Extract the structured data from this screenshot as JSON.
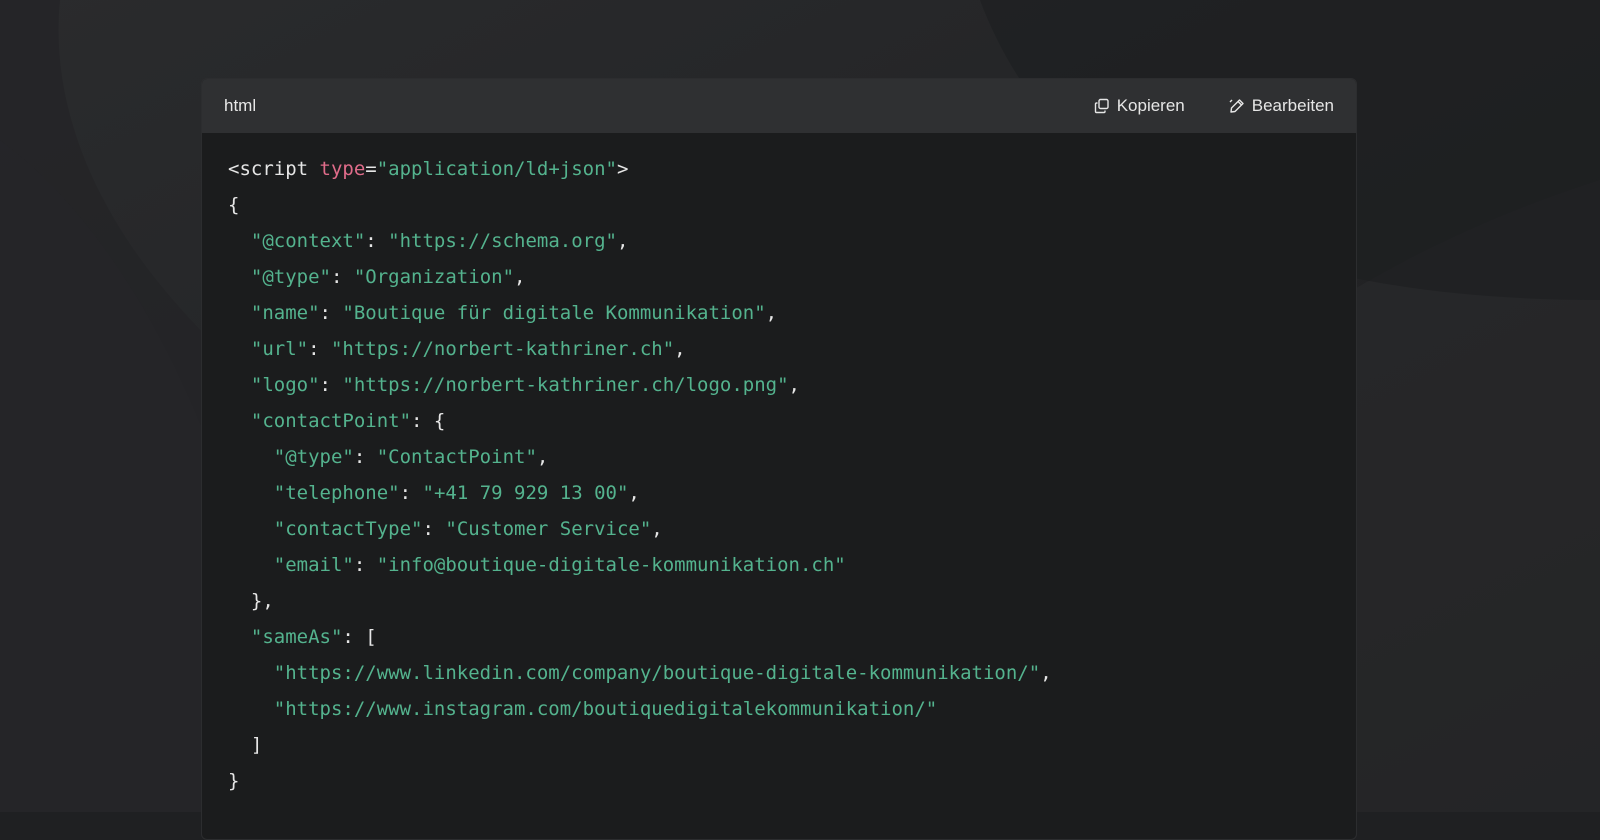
{
  "header": {
    "language": "html",
    "copy_label": "Kopieren",
    "edit_label": "Bearbeiten"
  },
  "icons": {
    "copy": "copy-icon",
    "edit": "pencil-icon"
  },
  "colors": {
    "string": "#54b38e",
    "attribute": "#e06c8a",
    "text": "#e6e6e6",
    "header_bg": "#2f3032",
    "code_bg": "#1b1c1d"
  },
  "code_lines": [
    [
      {
        "t": "<script ",
        "c": "plain"
      },
      {
        "t": "type",
        "c": "attr"
      },
      {
        "t": "=",
        "c": "plain"
      },
      {
        "t": "\"application/ld+json\"",
        "c": "str"
      },
      {
        "t": ">",
        "c": "plain"
      }
    ],
    [
      {
        "t": "{",
        "c": "plain"
      }
    ],
    [
      {
        "t": "  ",
        "c": "plain"
      },
      {
        "t": "\"@context\"",
        "c": "str"
      },
      {
        "t": ": ",
        "c": "plain"
      },
      {
        "t": "\"https://schema.org\"",
        "c": "str"
      },
      {
        "t": ",",
        "c": "plain"
      }
    ],
    [
      {
        "t": "  ",
        "c": "plain"
      },
      {
        "t": "\"@type\"",
        "c": "str"
      },
      {
        "t": ": ",
        "c": "plain"
      },
      {
        "t": "\"Organization\"",
        "c": "str"
      },
      {
        "t": ",",
        "c": "plain"
      }
    ],
    [
      {
        "t": "  ",
        "c": "plain"
      },
      {
        "t": "\"name\"",
        "c": "str"
      },
      {
        "t": ": ",
        "c": "plain"
      },
      {
        "t": "\"Boutique für digitale Kommunikation\"",
        "c": "str"
      },
      {
        "t": ",",
        "c": "plain"
      }
    ],
    [
      {
        "t": "  ",
        "c": "plain"
      },
      {
        "t": "\"url\"",
        "c": "str"
      },
      {
        "t": ": ",
        "c": "plain"
      },
      {
        "t": "\"https://norbert-kathriner.ch\"",
        "c": "str"
      },
      {
        "t": ",",
        "c": "plain"
      }
    ],
    [
      {
        "t": "  ",
        "c": "plain"
      },
      {
        "t": "\"logo\"",
        "c": "str"
      },
      {
        "t": ": ",
        "c": "plain"
      },
      {
        "t": "\"https://norbert-kathriner.ch/logo.png\"",
        "c": "str"
      },
      {
        "t": ",",
        "c": "plain"
      }
    ],
    [
      {
        "t": "  ",
        "c": "plain"
      },
      {
        "t": "\"contactPoint\"",
        "c": "str"
      },
      {
        "t": ": {",
        "c": "plain"
      }
    ],
    [
      {
        "t": "    ",
        "c": "plain"
      },
      {
        "t": "\"@type\"",
        "c": "str"
      },
      {
        "t": ": ",
        "c": "plain"
      },
      {
        "t": "\"ContactPoint\"",
        "c": "str"
      },
      {
        "t": ",",
        "c": "plain"
      }
    ],
    [
      {
        "t": "    ",
        "c": "plain"
      },
      {
        "t": "\"telephone\"",
        "c": "str"
      },
      {
        "t": ": ",
        "c": "plain"
      },
      {
        "t": "\"+41 79 929 13 00\"",
        "c": "str"
      },
      {
        "t": ",",
        "c": "plain"
      }
    ],
    [
      {
        "t": "    ",
        "c": "plain"
      },
      {
        "t": "\"contactType\"",
        "c": "str"
      },
      {
        "t": ": ",
        "c": "plain"
      },
      {
        "t": "\"Customer Service\"",
        "c": "str"
      },
      {
        "t": ",",
        "c": "plain"
      }
    ],
    [
      {
        "t": "    ",
        "c": "plain"
      },
      {
        "t": "\"email\"",
        "c": "str"
      },
      {
        "t": ": ",
        "c": "plain"
      },
      {
        "t": "\"info@boutique-digitale-kommunikation.ch\"",
        "c": "str"
      }
    ],
    [
      {
        "t": "  },",
        "c": "plain"
      }
    ],
    [
      {
        "t": "  ",
        "c": "plain"
      },
      {
        "t": "\"sameAs\"",
        "c": "str"
      },
      {
        "t": ": [",
        "c": "plain"
      }
    ],
    [
      {
        "t": "    ",
        "c": "plain"
      },
      {
        "t": "\"https://www.linkedin.com/company/boutique-digitale-kommunikation/\"",
        "c": "str"
      },
      {
        "t": ",",
        "c": "plain"
      }
    ],
    [
      {
        "t": "    ",
        "c": "plain"
      },
      {
        "t": "\"https://www.instagram.com/boutiquedigitalekommunikation/\"",
        "c": "str"
      }
    ],
    [
      {
        "t": "  ]",
        "c": "plain"
      }
    ],
    [
      {
        "t": "}",
        "c": "plain"
      }
    ]
  ]
}
